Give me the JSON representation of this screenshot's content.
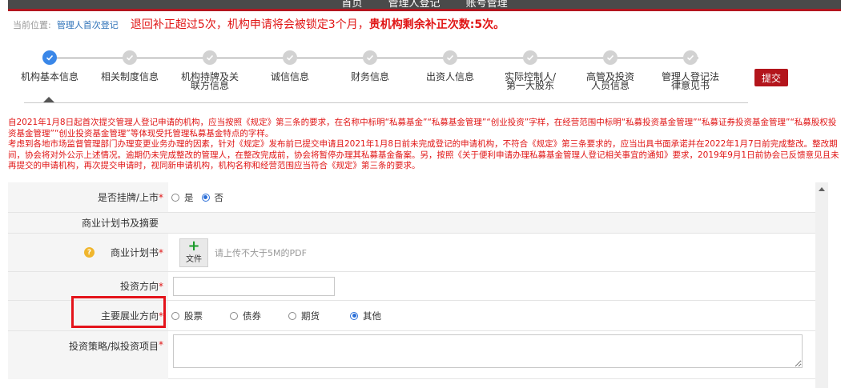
{
  "nav": {
    "items": [
      "首页",
      "管理人登记",
      "账号管理"
    ]
  },
  "breadcrumb": {
    "label": "当前位置:",
    "current": "管理人首次登记",
    "warning_text": "退回补正超过5次，机构申请将会被锁定3个月，",
    "warning_bold": "贵机构剩余补正次数:5次。"
  },
  "steps": [
    {
      "name": "机构基本信息",
      "active": true
    },
    {
      "name": "相关制度信息"
    },
    {
      "name": "机构持牌及关联方信息"
    },
    {
      "name": "诚信信息"
    },
    {
      "name": "财务信息"
    },
    {
      "name": "出资人信息"
    },
    {
      "name": "实际控制人/第一大股东"
    },
    {
      "name": "高管及投资人员信息"
    },
    {
      "name": "管理人登记法律意见书"
    }
  ],
  "submit_label": "提交",
  "notice": {
    "p1": "自2021年1月8日起首次提交管理人登记申请的机构，应当按照《规定》第三条的要求，在名称中标明“私募基金”“私募基金管理”“创业投资”字样，在经营范围中标明“私募投资基金管理”“私募证券投资基金管理”“私募股权投资基金管理”“创业投资基金管理”等体现受托管理私募基金特点的字样。",
    "p2": "考虑到各地市场监督管理部门办理变更业务办理的因素，针对《规定》发布前已提交申请且2021年1月8日前未完成登记的申请机构，不符合《规定》第三条要求的，应当出具书面承诺并在2022年1月7日前完成整改。整改期间，协会将对外公示上述情况。逾期仍未完成整改的管理人，在整改完成前，协会将暂停办理其私募基金备案。另，按照《关于便利申请办理私募基金管理人登记相关事宜的通知》要求，2019年9月1日前协会已反馈意见且未再提交的申请机构，再次提交申请时，视同新申请机构，机构名称和经营范围应当符合《规定》第三条的要求。"
  },
  "form": {
    "listed": {
      "label": "是否挂牌/上市",
      "req": "*",
      "opt_yes": "是",
      "opt_no": "否",
      "selected": "否"
    },
    "bp_section": {
      "label": "商业计划书及摘要"
    },
    "bp": {
      "label": "商业计划书",
      "req": "*",
      "upload_label": "文件",
      "hint": "请上传不大于5M的PDF"
    },
    "direction": {
      "label": "投资方向",
      "req": "*",
      "value": ""
    },
    "main_business": {
      "label": "主要展业方向",
      "req": "*",
      "options": [
        "股票",
        "债券",
        "期货",
        "其他"
      ],
      "selected": "其他"
    },
    "strategy": {
      "label": "投资策略/拟投资项目",
      "req": "*",
      "value": ""
    }
  },
  "colors": {
    "brand_red": "#b3151c",
    "warning_red": "#e01515",
    "link_blue": "#2e72b8",
    "active_step": "#3a87e8"
  }
}
